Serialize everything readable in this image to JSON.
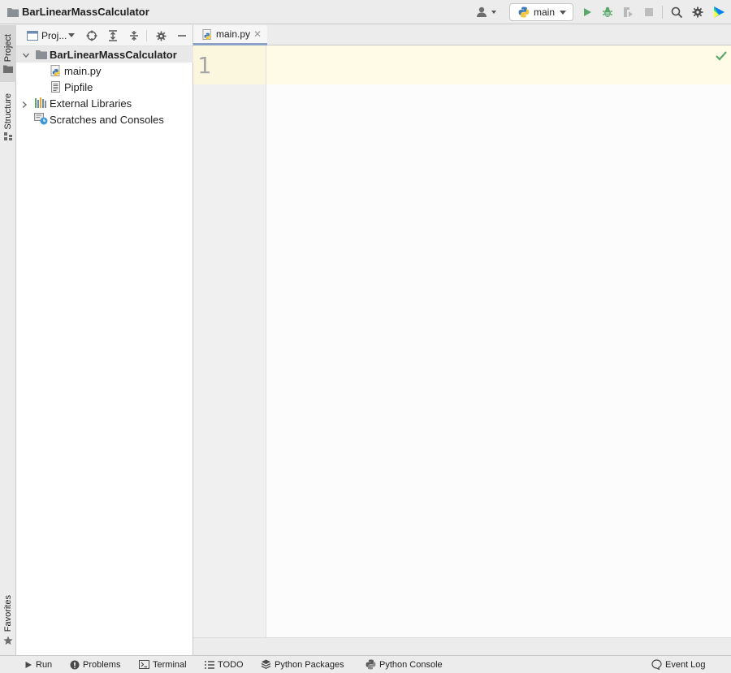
{
  "title_bar": {
    "project_name": "BarLinearMassCalculator",
    "run_config": "main",
    "icons": [
      "user-icon",
      "python-icon",
      "run-icon",
      "debug-icon",
      "coverage-icon",
      "stop-icon",
      "search-icon",
      "settings-icon",
      "toolbox-icon"
    ]
  },
  "left_strip": {
    "tabs": [
      "Project",
      "Structure",
      "Favorites"
    ]
  },
  "project_panel": {
    "view_label": "Proj...",
    "tree": [
      {
        "label": "BarLinearMassCalculator",
        "icon": "folder-icon",
        "bold": true
      },
      {
        "label": "main.py",
        "icon": "python-file-icon"
      },
      {
        "label": "Pipfile",
        "icon": "text-file-icon"
      },
      {
        "label": "External Libraries",
        "icon": "libraries-icon"
      },
      {
        "label": "Scratches and Consoles",
        "icon": "scratches-icon"
      }
    ]
  },
  "editor": {
    "tab_label": "main.py",
    "line_numbers": [
      "1"
    ]
  },
  "bottom_bar": {
    "items": [
      "Run",
      "Problems",
      "Terminal",
      "TODO",
      "Python Packages",
      "Python Console"
    ],
    "event_log": "Event Log"
  },
  "colors": {
    "accent": "#8aa2c8",
    "run_green": "#59a869",
    "current_line": "#fffbe6"
  }
}
